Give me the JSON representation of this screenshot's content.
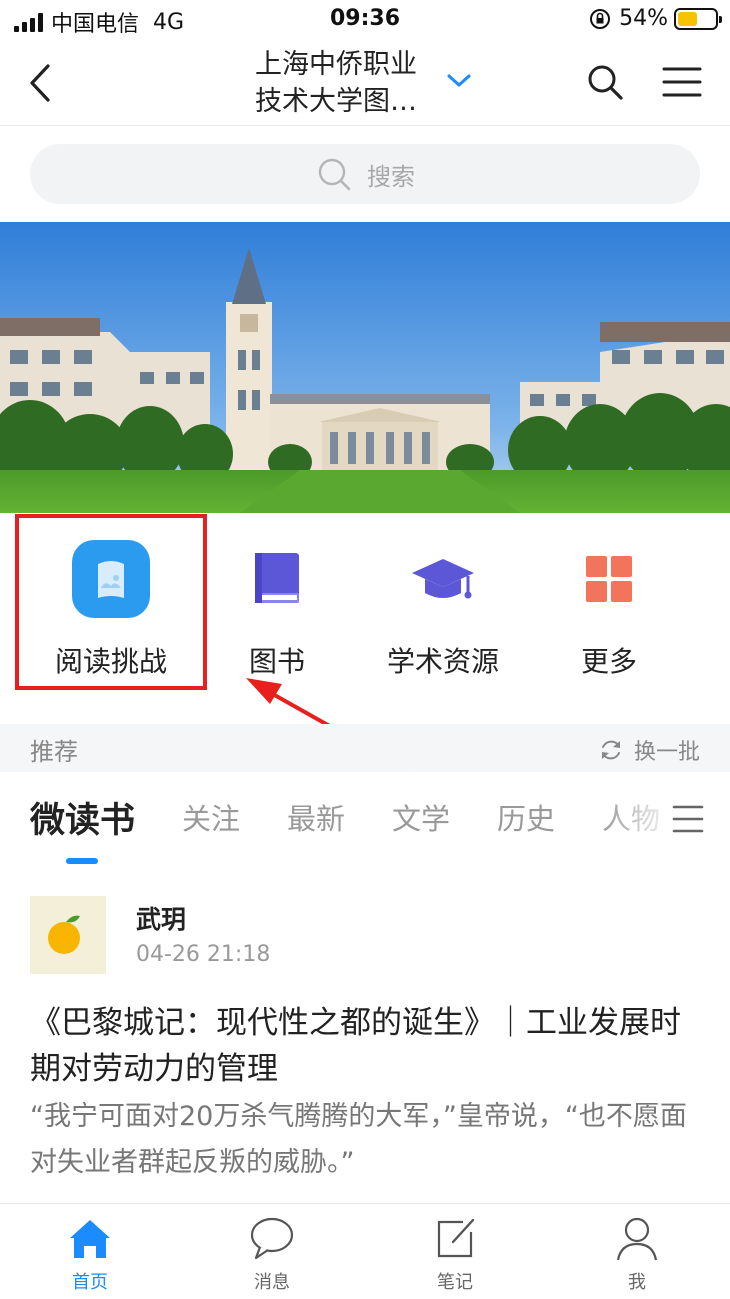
{
  "status_bar": {
    "carrier": "中国电信",
    "network": "4G",
    "time": "09:36",
    "battery": "54%",
    "battery_level": 0.54
  },
  "nav": {
    "title_line1": "上海中侨职业",
    "title_line2": "技术大学图…",
    "back_icon": "chevron-left-icon",
    "search_icon": "search-icon",
    "menu_icon": "hamburger-menu-icon"
  },
  "search": {
    "placeholder": "搜索"
  },
  "quick_links": [
    {
      "label": "阅读挑战",
      "icon": "reading-challenge-icon"
    },
    {
      "label": "图书",
      "icon": "book-icon"
    },
    {
      "label": "学术资源",
      "icon": "graduation-cap-icon"
    },
    {
      "label": "更多",
      "icon": "grid-icon"
    }
  ],
  "recommend": {
    "title": "推荐",
    "refresh_label": "换一批"
  },
  "tabs": [
    "微读书",
    "关注",
    "最新",
    "文学",
    "历史",
    "人物"
  ],
  "post": {
    "author": "武玥",
    "time": "04-26 21:18",
    "title": "《巴黎城记：现代性之都的诞生》｜工业发展时期对劳动力的管理",
    "excerpt": "“我宁可面对20万杀气腾腾的大军，”皇帝说，“也不愿面对失业者群起反叛的威胁。”"
  },
  "tabbar": [
    {
      "label": "首页",
      "icon": "home-icon",
      "active": true
    },
    {
      "label": "消息",
      "icon": "message-icon",
      "active": false
    },
    {
      "label": "笔记",
      "icon": "note-icon",
      "active": false
    },
    {
      "label": "我",
      "icon": "user-icon",
      "active": false
    }
  ],
  "colors": {
    "accent": "#1a8cff",
    "highlight": "#e8201d",
    "book_purple": "#5b57d6",
    "more_orange": "#f2745a",
    "battery_yellow": "#f7c300"
  }
}
